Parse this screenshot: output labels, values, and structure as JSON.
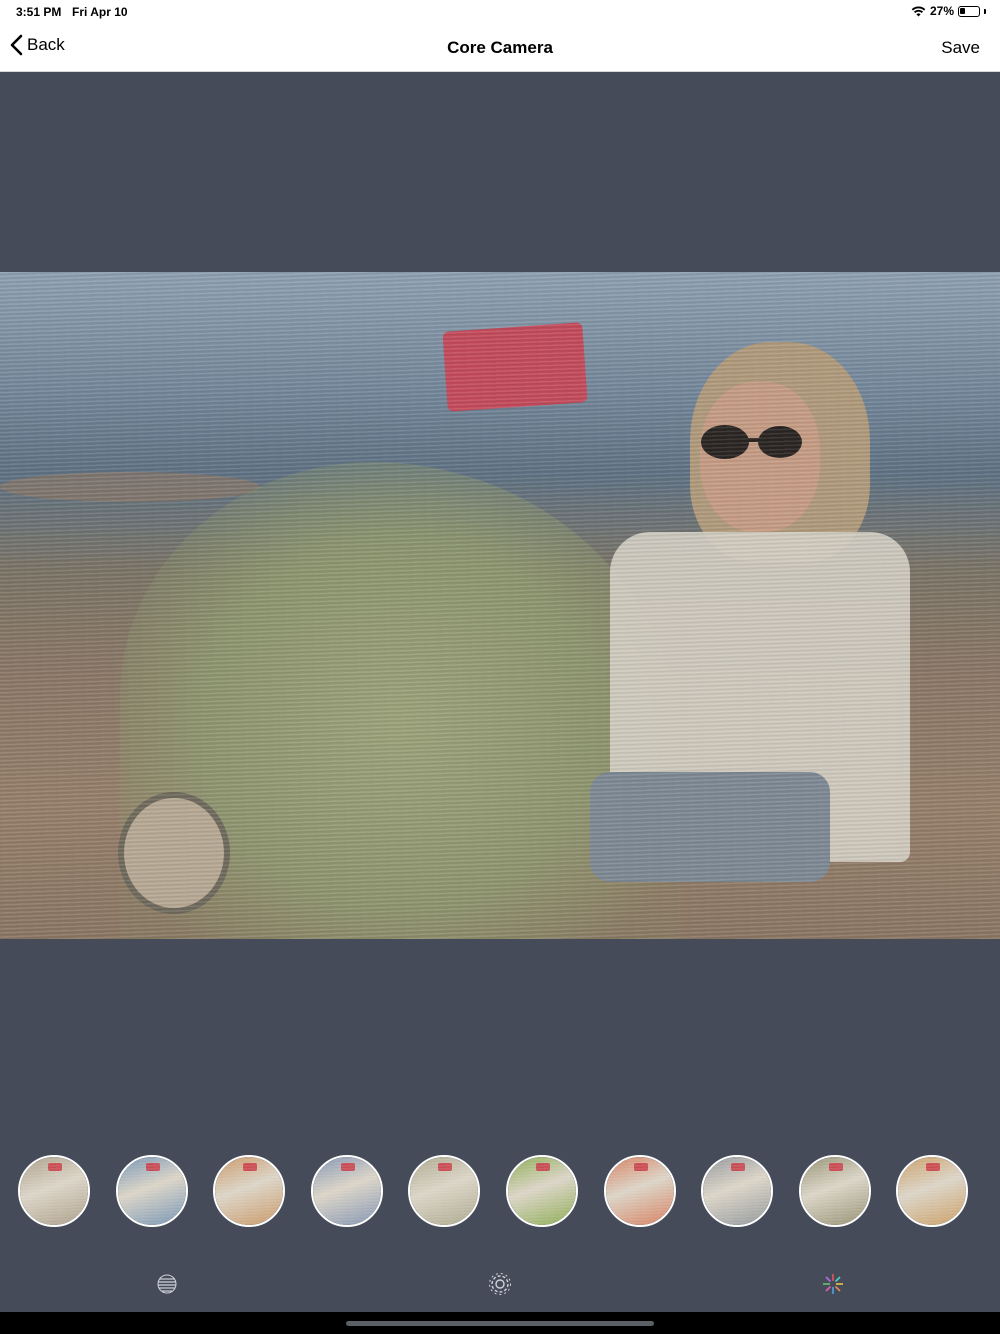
{
  "status_bar": {
    "time": "3:51 PM",
    "date": "Fri Apr 10",
    "battery": "27%",
    "battery_level": 0.27,
    "icons": [
      "wifi-icon",
      "battery-icon"
    ]
  },
  "nav": {
    "back_label": "Back",
    "title": "Core Camera",
    "save_label": "Save"
  },
  "photo": {
    "description_icon": "edited-photo"
  },
  "filters": [
    {
      "name": "filter-1",
      "color": "#a89a84"
    },
    {
      "name": "filter-2",
      "color": "#6f8fb0"
    },
    {
      "name": "filter-3",
      "color": "#c7935f"
    },
    {
      "name": "filter-4",
      "color": "#7d8fae"
    },
    {
      "name": "filter-5",
      "color": "#a8a487"
    },
    {
      "name": "filter-6",
      "color": "#87a84a"
    },
    {
      "name": "filter-7",
      "color": "#d47958"
    },
    {
      "name": "filter-8",
      "color": "#8d9296"
    },
    {
      "name": "filter-9",
      "color": "#8f8c6b"
    },
    {
      "name": "filter-10",
      "color": "#c99a5e"
    }
  ],
  "toolbar": {
    "items": [
      {
        "icon": "texture-sphere-icon"
      },
      {
        "icon": "settings-gear-icon"
      },
      {
        "icon": "color-burst-icon"
      }
    ]
  },
  "colors": {
    "background": "#454b59",
    "bar": "#ffffff",
    "home_bar": "#000000"
  }
}
